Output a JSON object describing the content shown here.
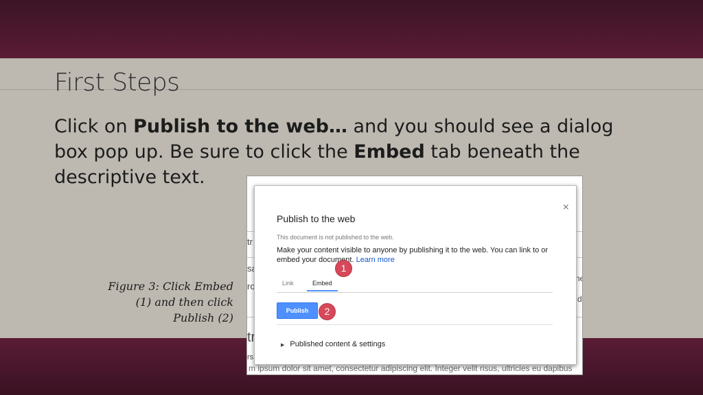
{
  "slide": {
    "title": "First Steps",
    "body": {
      "p1": "Click on ",
      "b1": "Publish to the web…",
      "p2": " and you should see a dialog box pop up. Be sure to click the ",
      "b2": "Embed",
      "p3": " tab beneath the descriptive text."
    },
    "caption": {
      "line1": "Figure 3: Click Embed",
      "line2": "(1) and then click",
      "line3": "Publish (2)"
    }
  },
  "background_doc": {
    "frag_left_1": "tr",
    "frag_left_2": "sa",
    "frag_left_3": "ro",
    "frag_left_4": "tr",
    "frag_left_5": "rs",
    "frag_right_1": "ne",
    "frag_right_2": "d",
    "lorem": "m ipsum dolor sit amet, consectetur adipiscing elit. Integer velit risus, ultricies eu dapibus"
  },
  "dialog": {
    "title": "Publish to the web",
    "close_glyph": "×",
    "status": "This document is not published to the web.",
    "description": "Make your content visible to anyone by publishing it to the web. You can link to or embed your document.",
    "learn_more": "Learn more",
    "tabs": [
      {
        "label": "Link",
        "active": false
      },
      {
        "label": "Embed",
        "active": true
      }
    ],
    "publish_button": "Publish",
    "published_settings": "Published content & settings",
    "expander_glyph": "▶"
  },
  "annotations": {
    "badge1": "1",
    "badge2": "2",
    "badge_color": "#d6495a"
  },
  "colors": {
    "band": "#5a1c35",
    "slide_bg": "#bdb9b1",
    "button_blue": "#4d90fe",
    "link_blue": "#1155cc"
  }
}
